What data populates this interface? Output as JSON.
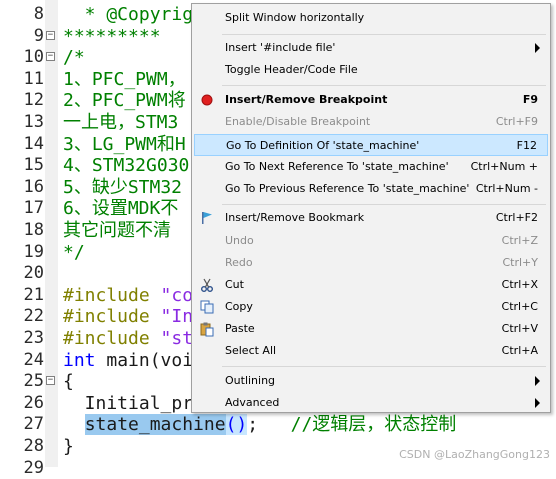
{
  "editor": {
    "lines": [
      {
        "num": "8"
      },
      {
        "num": "9"
      },
      {
        "num": "10"
      },
      {
        "num": "11"
      },
      {
        "num": "12"
      },
      {
        "num": "13"
      },
      {
        "num": "14"
      },
      {
        "num": "15"
      },
      {
        "num": "16"
      },
      {
        "num": "17"
      },
      {
        "num": "18"
      },
      {
        "num": "19"
      },
      {
        "num": "20"
      },
      {
        "num": "21"
      },
      {
        "num": "22"
      },
      {
        "num": "23"
      },
      {
        "num": "24"
      },
      {
        "num": "25"
      },
      {
        "num": "26"
      },
      {
        "num": "27"
      },
      {
        "num": "28"
      },
      {
        "num": "29"
      }
    ],
    "code": {
      "l8": "  * @Copyrig",
      "l9": "*********",
      "l10": "/*",
      "l11": "1、PFC_PWM，",
      "l12": "2、PFC_PWM将",
      "l13": "一上电，STM3",
      "l14": "3、LG_PWM和H",
      "l15": "4、STM32G030",
      "l16": "5、缺少STM32",
      "l17": "6、设置MDK不",
      "l18": "其它问题不清",
      "l19": "*/",
      "l21_kw": "#include",
      "l21_str": " \"co",
      "l22_kw": "#include",
      "l22_str": " \"In",
      "l23_kw": "#include",
      "l23_str": " \"st",
      "l24_kw": "int",
      "l24_rest": " main(voi",
      "l25": "{",
      "l26": "  Initial_pr",
      "l27_indent": "  ",
      "l27_sel": "state_machine",
      "l27_paren_open": "(",
      "l27_paren_close": ")",
      "l27_semi": ";",
      "l27_comment": "   //逻辑层，状态控制",
      "l28": "}"
    },
    "watermark": "CSDN @LaoZhangGong123"
  },
  "context_menu": {
    "items": {
      "split_window": {
        "label": "Split Window horizontally"
      },
      "insert_include": {
        "label": "Insert '#include file'"
      },
      "toggle_header": {
        "label": "Toggle Header/Code File"
      },
      "insert_breakpoint": {
        "label": "Insert/Remove Breakpoint",
        "shortcut": "F9",
        "icon": "breakpoint-icon"
      },
      "enable_breakpoint": {
        "label": "Enable/Disable Breakpoint",
        "shortcut": "Ctrl+F9"
      },
      "goto_definition": {
        "label": "Go To Definition Of 'state_machine'",
        "shortcut": "F12"
      },
      "goto_next_ref": {
        "label": "Go To Next Reference To 'state_machine'",
        "shortcut": "Ctrl+Num +"
      },
      "goto_prev_ref": {
        "label": "Go To Previous Reference To 'state_machine'",
        "shortcut": "Ctrl+Num -"
      },
      "insert_bookmark": {
        "label": "Insert/Remove Bookmark",
        "shortcut": "Ctrl+F2",
        "icon": "bookmark-flag-icon"
      },
      "undo": {
        "label": "Undo",
        "shortcut": "Ctrl+Z"
      },
      "redo": {
        "label": "Redo",
        "shortcut": "Ctrl+Y"
      },
      "cut": {
        "label": "Cut",
        "shortcut": "Ctrl+X",
        "icon": "scissors-icon"
      },
      "copy": {
        "label": "Copy",
        "shortcut": "Ctrl+C",
        "icon": "copy-icon"
      },
      "paste": {
        "label": "Paste",
        "shortcut": "Ctrl+V",
        "icon": "paste-icon"
      },
      "select_all": {
        "label": "Select All",
        "shortcut": "Ctrl+A"
      },
      "outlining": {
        "label": "Outlining"
      },
      "advanced": {
        "label": "Advanced"
      }
    }
  },
  "colors": {
    "comment": "#008000",
    "keyword": "#0000ff",
    "preprocessor": "#808000",
    "selection": "#99c9ef",
    "menu_highlight": "#cce8ff",
    "breakpoint": "#e02020"
  }
}
